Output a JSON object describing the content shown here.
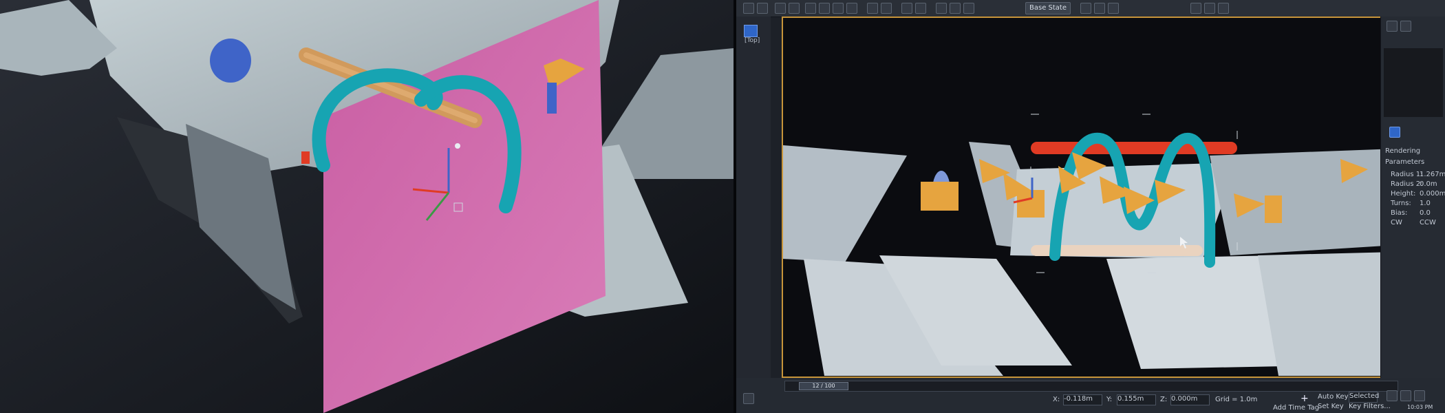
{
  "toolbar": {
    "state_sets_label": "Base State"
  },
  "viewport": {
    "label": "[Top]"
  },
  "command_panel": {
    "rendering_label": "Rendering",
    "parameters_label": "Parameters",
    "params": [
      {
        "label": "Radius 1:",
        "value": "1.267m"
      },
      {
        "label": "Radius 2:",
        "value": "0.0m"
      },
      {
        "label": "Height:",
        "value": "0.000m"
      },
      {
        "label": "Turns:",
        "value": "1.0"
      },
      {
        "label": "Bias:",
        "value": "0.0"
      },
      {
        "label": "CW",
        "value": "CCW"
      }
    ]
  },
  "status": {
    "frame_counter": "12 / 100",
    "x_label": "X:",
    "x_value": "-0.118m",
    "y_label": "Y:",
    "y_value": "0.155m",
    "z_label": "Z:",
    "z_value": "0.000m",
    "grid_label": "Grid = 1.0m",
    "add_time_tag": "Add Time Tag",
    "auto_key_label": "Auto Key",
    "selected_label": "Selected",
    "set_key_label": "Set Key",
    "key_filters_label": "Key Filters...",
    "clock": "10:03 PM"
  },
  "colors": {
    "pink_plane": "#d06aaa",
    "teal_tube": "#17a4b2",
    "orange_prim": "#e6a43f",
    "selection_border": "#c8953a",
    "blue_sphere": "#3f64c8",
    "red_cylinder": "#e03b24"
  }
}
